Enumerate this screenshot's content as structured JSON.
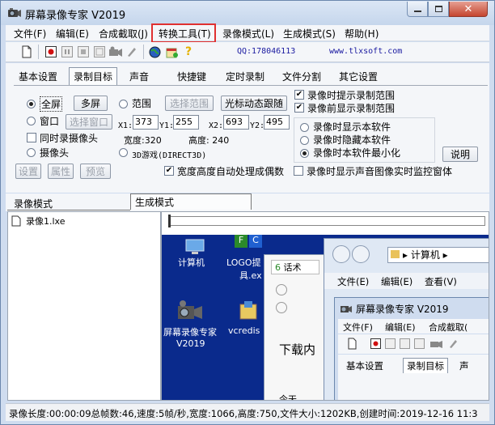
{
  "window": {
    "title": "屏幕录像专家 V2019"
  },
  "menu": [
    "文件(F)",
    "编辑(E)",
    "合成截取(J)",
    "转换工具(T)",
    "录像模式(L)",
    "生成模式(S)",
    "帮助(H)"
  ],
  "toolbar": {
    "qq": "QQ:178046113",
    "site": "www.tlxsoft.com"
  },
  "tabs": [
    "基本设置",
    "录制目标",
    "声音",
    "快捷键",
    "定时录制",
    "文件分割",
    "其它设置"
  ],
  "record": {
    "fullscreen": "全屏",
    "multiscreen": "多屏",
    "range": "范围",
    "select_range": "选择范围",
    "cursor_follow": "光标动态跟随",
    "window": "窗口",
    "select_window": "选择窗口",
    "x1_label": "X1:",
    "x1": "373",
    "y1_label": "Y1:",
    "y1": "255",
    "x2_label": "X2:",
    "x2": "693",
    "y2_label": "Y2:",
    "y2": "495",
    "width_label": "宽度:320",
    "height_label": "高度: 240",
    "camera_sync": "同时录摄像头",
    "camera": "摄像头",
    "game3d": "3D游戏(DIRECT3D)",
    "settings": "设置",
    "props": "属性",
    "preview": "预览",
    "auto_even": "宽度高度自动处理成偶数",
    "hint_range": "录像时提示录制范围",
    "show_range": "录像前显示录制范围",
    "show_soft": "录像时显示本软件",
    "hide_soft": "录像时隐藏本软件",
    "minimize_soft": "录像时本软件最小化",
    "help": "说明",
    "monitor_window": "录像时显示声音图像实时监控窗体"
  },
  "lower_tabs": [
    "录像模式",
    "生成模式"
  ],
  "files": [
    "录像1.lxe"
  ],
  "preview": {
    "desktop": [
      "计算机",
      "LOGO提",
      "具.ex",
      "屏幕录像专家",
      "V2019",
      "vcredis"
    ],
    "explorer_path": "计算机",
    "explorer_menu": [
      "文件(E)",
      "编辑(E)",
      "查看(V)"
    ],
    "browser_tab": "话术",
    "browser_text": "下载内",
    "browser_today": "今天",
    "inner_title": "屏幕录像专家 V2019",
    "inner_menu": [
      "文件(F)",
      "编辑(E)",
      "合成截取("
    ],
    "inner_tabs": [
      "基本设置",
      "录制目标",
      "声"
    ]
  },
  "status": "录像长度:00:00:09总帧数:46,速度:5帧/秒,宽度:1066,高度:750,文件大小:1202KB,创建时间:2019-12-16 11:3"
}
